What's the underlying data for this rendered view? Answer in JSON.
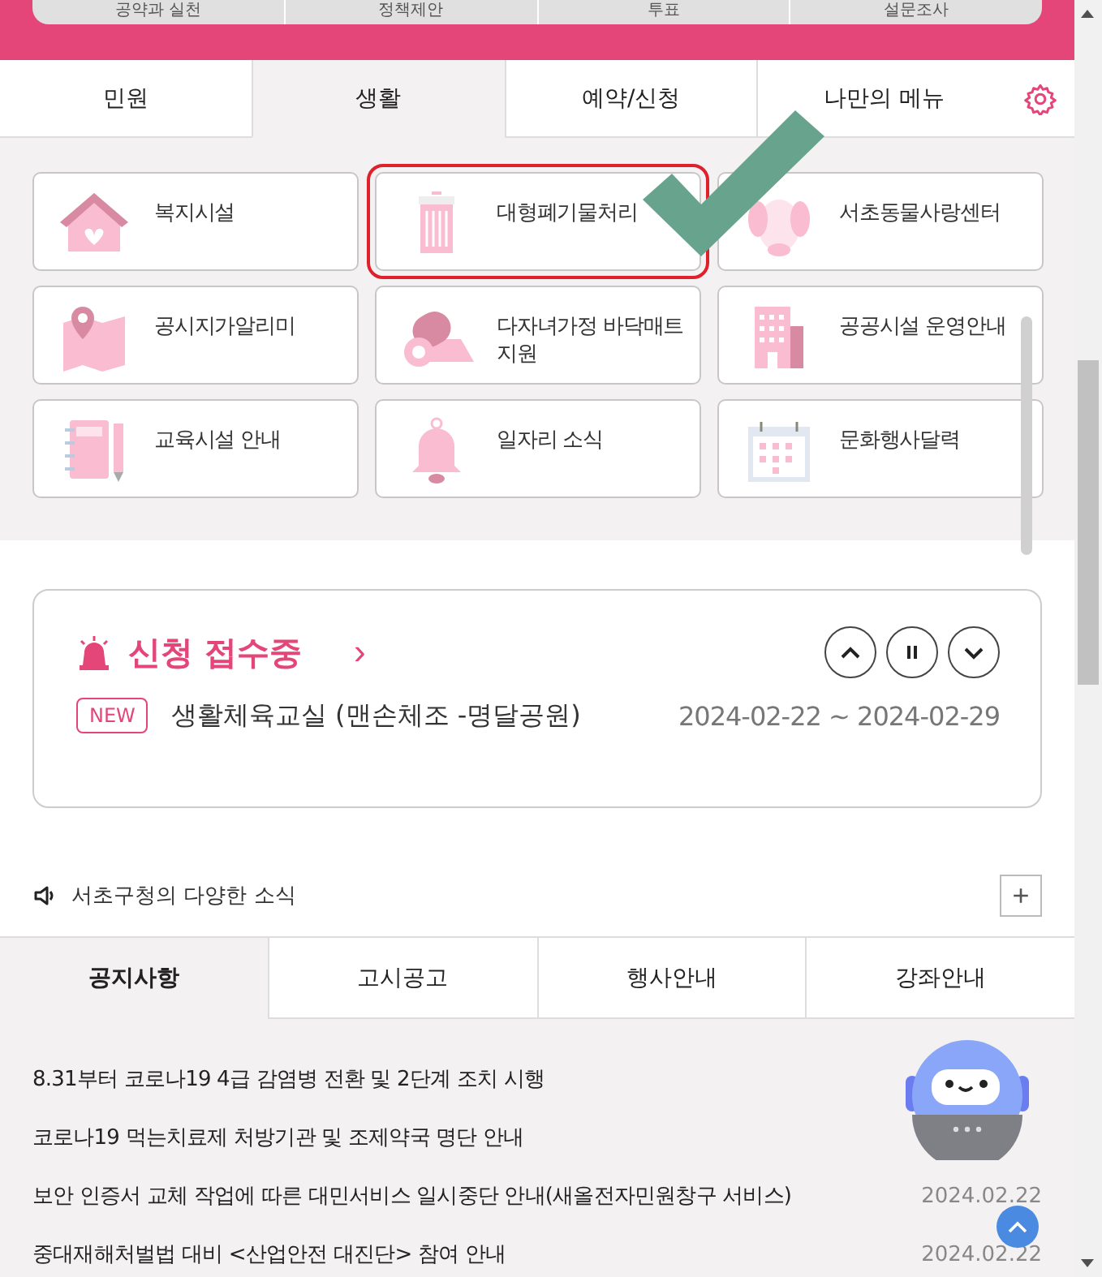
{
  "top_menu": [
    {
      "label": "공약과 실천"
    },
    {
      "label": "정책제안"
    },
    {
      "label": "투표"
    },
    {
      "label": "설문조사"
    }
  ],
  "tabs": [
    {
      "label": "민원",
      "selected": false
    },
    {
      "label": "생활",
      "selected": true
    },
    {
      "label": "예약/신청",
      "selected": false
    },
    {
      "label": "나만의 메뉴",
      "selected": false
    }
  ],
  "services": [
    {
      "label": "복지시설",
      "kind": "house",
      "highlighted": false
    },
    {
      "label": "대형폐기물처리",
      "kind": "trash",
      "highlighted": true
    },
    {
      "label": "서초동물사랑센터",
      "kind": "dog",
      "highlighted": false
    },
    {
      "label": "공시지가알리미",
      "kind": "map",
      "highlighted": false
    },
    {
      "label": "다자녀가정 바닥매트지원",
      "kind": "mat",
      "highlighted": false
    },
    {
      "label": "공공시설 운영안내",
      "kind": "building",
      "highlighted": false
    },
    {
      "label": "교육시설 안내",
      "kind": "notebook",
      "highlighted": false
    },
    {
      "label": "일자리 소식",
      "kind": "bell",
      "highlighted": false
    },
    {
      "label": "문화행사달력",
      "kind": "calendar",
      "highlighted": false
    }
  ],
  "application": {
    "title": "신청 접수중",
    "more": "›",
    "badge": "NEW",
    "item": "생활체육교실 (맨손체조 -명달공원)",
    "period": "2024-02-22 ~ 2024-02-29"
  },
  "news": {
    "title": "서초구청의 다양한 소식",
    "more": "+"
  },
  "news_tabs": [
    {
      "label": "공지사항",
      "selected": true
    },
    {
      "label": "고시공고",
      "selected": false
    },
    {
      "label": "행사안내",
      "selected": false
    },
    {
      "label": "강좌안내",
      "selected": false
    }
  ],
  "notices": [
    {
      "title": "8.31부터 코로나19 4급 감염병 전환 및 2단계 조치 시행"
    },
    {
      "title": "코로나19 먹는치료제 처방기관 및 조제약국 명단 안내"
    },
    {
      "title": "보안 인증서 교체 작업에 따른 대민서비스 일시중단 안내(새올전자민원창구 서비스)",
      "date": "2024.02.22"
    },
    {
      "title": "중대재해처벌법 대비 <산업안전 대진단> 참여 안내",
      "date": "2024.02.22"
    }
  ]
}
